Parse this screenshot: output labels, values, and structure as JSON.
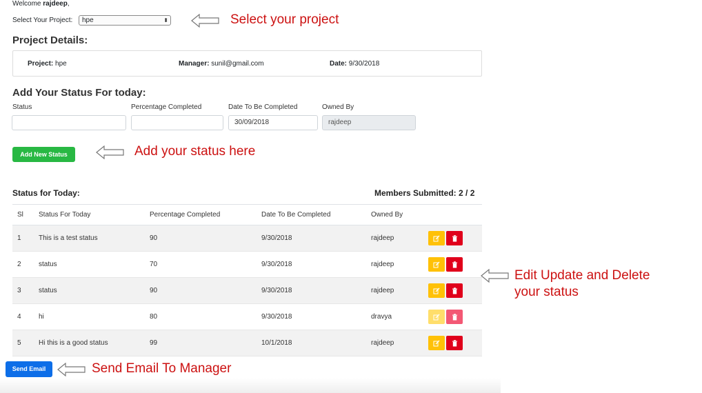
{
  "welcome": {
    "prefix": "Welcome ",
    "user": "rajdeep",
    "suffix": ","
  },
  "project_select": {
    "label": "Select Your Project:",
    "value": "hpe"
  },
  "project_details": {
    "heading": "Project Details:",
    "project_key": "Project:",
    "project_val": "hpe",
    "manager_key": "Manager:",
    "manager_val": "sunil@gmail.com",
    "date_key": "Date:",
    "date_val": "9/30/2018"
  },
  "status_form": {
    "heading": "Add Your Status For today:",
    "status_label": "Status",
    "status_value": "",
    "percentage_label": "Percentage Completed",
    "percentage_value": "",
    "date_label": "Date To Be Completed",
    "date_value": "30/09/2018",
    "owner_label": "Owned By",
    "owner_value": "rajdeep",
    "add_button": "Add New Status"
  },
  "status_table": {
    "heading": "Status for Today:",
    "members_label": "Members Submitted: 2 / 2",
    "columns": [
      "Sl",
      "Status For Today",
      "Percentage Completed",
      "Date To Be Completed",
      "Owned By"
    ],
    "rows": [
      {
        "sl": "1",
        "status": "This is a test status",
        "pct": "90",
        "date": "9/30/2018",
        "owner": "rajdeep",
        "enabled": true
      },
      {
        "sl": "2",
        "status": "status",
        "pct": "70",
        "date": "9/30/2018",
        "owner": "rajdeep",
        "enabled": true
      },
      {
        "sl": "3",
        "status": "status",
        "pct": "90",
        "date": "9/30/2018",
        "owner": "rajdeep",
        "enabled": true
      },
      {
        "sl": "4",
        "status": "hi",
        "pct": "80",
        "date": "9/30/2018",
        "owner": "dravya",
        "enabled": false
      },
      {
        "sl": "5",
        "status": "Hi this is a good status",
        "pct": "99",
        "date": "10/1/2018",
        "owner": "rajdeep",
        "enabled": true
      }
    ]
  },
  "send_email_button": "Send Email",
  "annotations": {
    "select_project": "Select your project",
    "add_status": "Add your status here",
    "edit_delete_line1": "Edit Update and Delete",
    "edit_delete_line2": "your status",
    "send_email": "Send Email To Manager"
  },
  "colors": {
    "add_button": "#28b843",
    "send_button": "#0d6ee8",
    "edit_button": "#ffc107",
    "delete_button": "#e0001b",
    "annotation_text": "#cc1111"
  },
  "icons": {
    "edit": "edit-icon",
    "delete": "trash-icon",
    "arrow": "left-arrow-icon",
    "dropdown": "select-caret-icon"
  }
}
